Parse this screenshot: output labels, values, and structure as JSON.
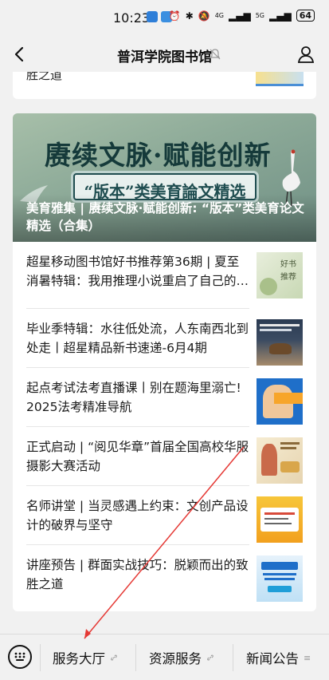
{
  "status_bar": {
    "time": "10:23",
    "signal_1": "4G",
    "signal_2": "5G",
    "battery": "64"
  },
  "nav": {
    "title": "普洱学院图书馆"
  },
  "partial_card": {
    "text": "胜之道"
  },
  "banner": {
    "title": "赓续文脉·赋能创新",
    "subtitle": "“版本”类美育論文精选",
    "caption": "美育雅集 | 赓续文脉·赋能创新: “版本”类美育论文精选（合集）"
  },
  "articles": [
    {
      "title": "超星移动图书馆好书推荐第36期 | 夏至消暑特辑：我用推理小说重启了自己的…",
      "thumb": "book-recommend"
    },
    {
      "title": "毕业季特辑：水往低处流，人东南西北到处走丨超星精品新书速递-6月4期",
      "thumb": "graduation"
    },
    {
      "title": "起点考试法考直播课丨别在题海里溺亡! 2025法考精准导航",
      "thumb": "law-exam"
    },
    {
      "title": "正式启动 | “阅见华章”首届全国高校华服摄影大赛活动",
      "thumb": "hanfu-photo"
    },
    {
      "title": "名师讲堂 | 当灵感遇上约束：文创产品设计的破界与坚守",
      "thumb": "lecture"
    },
    {
      "title": "讲座预告 | 群面实战技巧：脱颖而出的致胜之道",
      "thumb": "group-interview"
    }
  ],
  "bottom_menu": {
    "items": [
      "服务大厅",
      "资源服务",
      "新闻公告"
    ]
  },
  "colors": {
    "background": "#f1f1f1",
    "card": "#ffffff",
    "banner_dark": "#153a3a",
    "annotation_arrow": "#e53935"
  }
}
